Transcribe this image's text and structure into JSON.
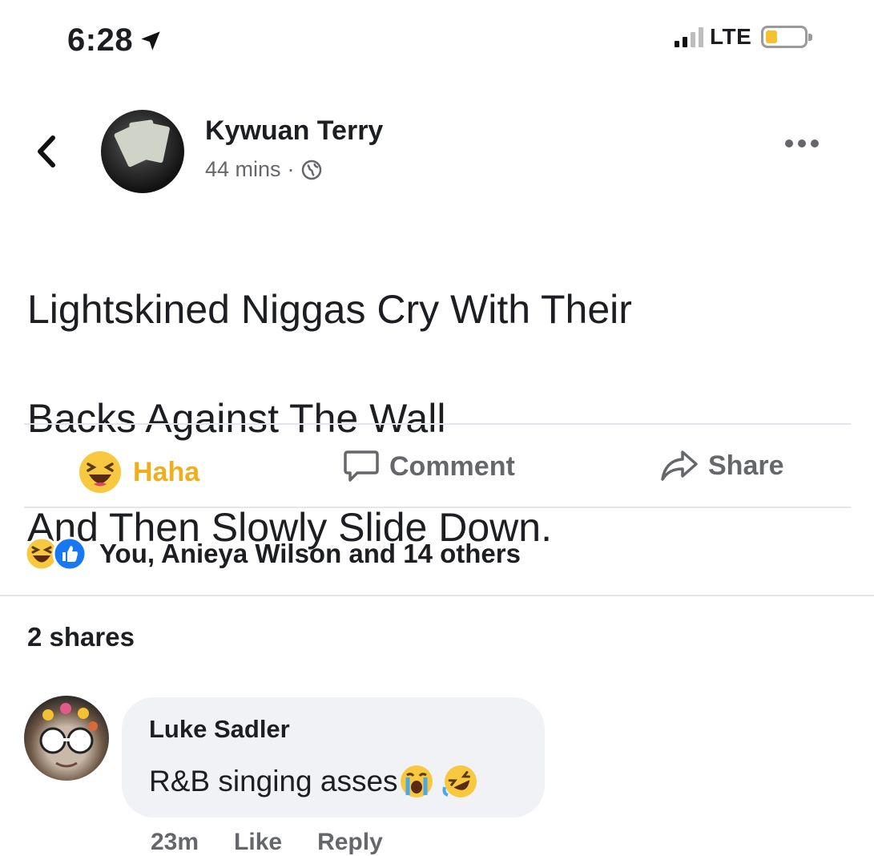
{
  "status_bar": {
    "time": "6:28",
    "network": "LTE",
    "colors": {
      "battery_fill": "#f2c230"
    }
  },
  "post": {
    "author": "Kywuan Terry",
    "timestamp": "44 mins",
    "separator": "·",
    "text_lines": [
      "Lightskined Niggas Cry With Their",
      "Backs Against The Wall",
      "And Then Slowly Slide Down."
    ]
  },
  "actions": {
    "haha_label": "Haha",
    "comment_label": "Comment",
    "share_label": "Share",
    "colors": {
      "haha_active": "#f0ad1e",
      "inactive": "#65676b"
    }
  },
  "reactions": {
    "summary": "You, Anieya Wilson and 14 others",
    "icons": [
      "haha-reaction-icon",
      "like-reaction-icon"
    ]
  },
  "shares": "2 shares",
  "comment": {
    "author": "Luke Sadler",
    "text": "R&B singing asses",
    "emojis": [
      "loudly-crying-face-icon",
      "rolling-on-floor-laughing-icon"
    ],
    "time": "23m",
    "like_label": "Like",
    "reply_label": "Reply"
  }
}
